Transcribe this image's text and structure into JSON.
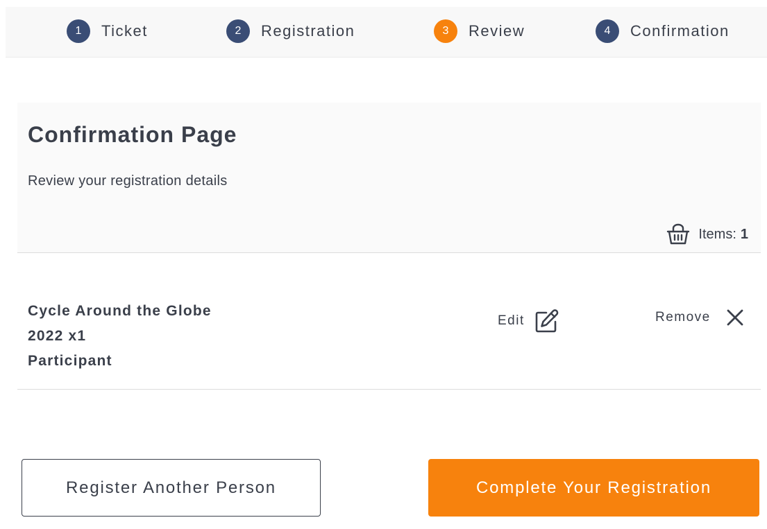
{
  "stepper": {
    "steps": [
      {
        "number": "1",
        "label": "Ticket"
      },
      {
        "number": "2",
        "label": "Registration"
      },
      {
        "number": "3",
        "label": "Review"
      },
      {
        "number": "4",
        "label": "Confirmation"
      }
    ],
    "active_step": 3
  },
  "panel": {
    "title": "Confirmation Page",
    "subtitle": "Review your registration details",
    "cart_label": "Items:",
    "cart_count": "1",
    "cart_icon": "basket-icon"
  },
  "item": {
    "name_line1": "Cycle Around the Globe",
    "name_line2": "2022 x1",
    "type": "Participant",
    "edit_label": "Edit",
    "edit_icon": "pencil-square-icon",
    "remove_label": "Remove",
    "remove_icon": "close-icon"
  },
  "actions": {
    "secondary_label": "Register Another Person",
    "primary_label": "Complete Your Registration"
  },
  "colors": {
    "accent": "#f7820d",
    "step_inactive": "#3a4d75",
    "text": "#3a3f4a"
  }
}
